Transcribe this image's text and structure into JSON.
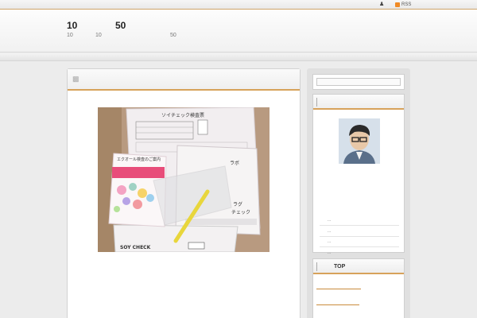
{
  "topbar": {
    "person_icon": "person-icon",
    "rss_icon": "rss-icon",
    "rss_label": "RSS"
  },
  "header": {
    "title_parts": [
      "10",
      "50"
    ],
    "tagline_parts": [
      "10",
      "10",
      "50"
    ]
  },
  "sidebar": {
    "profile_links": [
      "...",
      "...",
      "...",
      "..."
    ],
    "top_widget_title": "TOP"
  },
  "photo": {
    "doc_title": "ソイチェック検査票",
    "card_title": "エクオール検査のご案内",
    "lab_text": "ラボ",
    "check_text": "ラグ",
    "check_text2": "チェック",
    "soy_label": "SOY CHECK"
  },
  "colors": {
    "accent": "#d7a25a",
    "rss": "#f08a24"
  }
}
